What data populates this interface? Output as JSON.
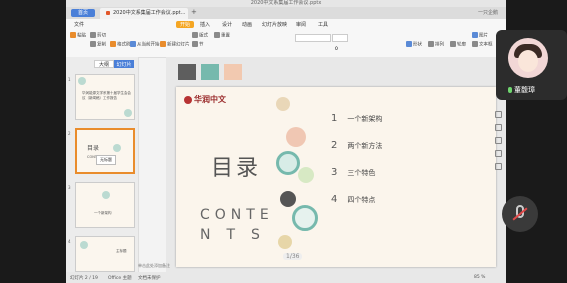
{
  "window": {
    "title": "2020中文系集届工作会议.pptx",
    "login": "一只企鹅"
  },
  "tabs": {
    "home": "首页",
    "doc": "2020中文系集届工作会议.ppt...",
    "plus": "+"
  },
  "menu": {
    "file": "文件",
    "start": "开始",
    "insert": "插入",
    "design": "设计",
    "animation": "动画",
    "slideshow": "幻灯片放映",
    "review": "审阅",
    "tools": "工具"
  },
  "toolbar": {
    "cut": "剪切",
    "copy": "复制",
    "paste": "粘贴",
    "format_painter": "格式刷",
    "from_current": "从当前开始",
    "new_slide": "新建幻灯片",
    "layout": "版式",
    "section": "节",
    "reset": "重置",
    "font_size": "0",
    "shape": "形状",
    "arrange": "排列",
    "outline": "轮廓",
    "picture": "图片",
    "textbox": "文本框"
  },
  "sidebar": {
    "tab_outline": "大纲",
    "tab_slides": "幻灯片",
    "tooltip": "无标题",
    "thumbs": [
      {
        "num": "1",
        "title": "华润能源文学系第十届学生会会议（新闻稿）工作报告"
      },
      {
        "num": "2",
        "title": "目录"
      },
      {
        "num": "3",
        "title": "一个新架构"
      },
      {
        "num": "4",
        "title": "主标题"
      }
    ]
  },
  "slide": {
    "logo": "华润中文",
    "heading": "目录",
    "contents_line1": "CONTE",
    "contents_line2": "NTS",
    "items": [
      {
        "num": "1",
        "text": "一个新架构"
      },
      {
        "num": "2",
        "text": "两个新方法"
      },
      {
        "num": "3",
        "text": "三个特色"
      },
      {
        "num": "4",
        "text": "四个特点"
      }
    ],
    "page_count": "1/36"
  },
  "swatches": [
    "#5e5e5e",
    "#76b9ad",
    "#f2c9b0"
  ],
  "statusbar": {
    "slide_info": "幻灯片 2 / 19",
    "theme": "Office 主题",
    "doc_protect": "文档未保护",
    "notes_hint": "单击此处添加备注",
    "zoom": "85 %"
  },
  "video": {
    "name": "董馥璋"
  },
  "colors": {
    "accent": "#4a7fd8",
    "start_tab": "#f5a623",
    "logo_red": "#b73333",
    "teal": "#76b9ad"
  }
}
